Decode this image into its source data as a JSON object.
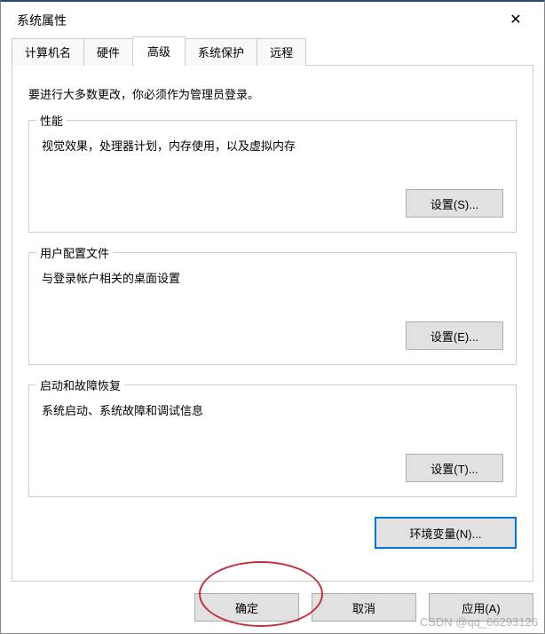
{
  "window": {
    "title": "系统属性"
  },
  "tabs": {
    "computer_name": "计算机名",
    "hardware": "硬件",
    "advanced": "高级",
    "system_protection": "系统保护",
    "remote": "远程"
  },
  "panel": {
    "instruction": "要进行大多数更改，你必须作为管理员登录。",
    "performance": {
      "title": "性能",
      "desc": "视觉效果，处理器计划，内存使用，以及虚拟内存",
      "button": "设置(S)..."
    },
    "user_profiles": {
      "title": "用户配置文件",
      "desc": "与登录帐户相关的桌面设置",
      "button": "设置(E)..."
    },
    "startup": {
      "title": "启动和故障恢复",
      "desc": "系统启动、系统故障和调试信息",
      "button": "设置(T)..."
    },
    "env_button": "环境变量(N)..."
  },
  "footer": {
    "ok": "确定",
    "cancel": "取消",
    "apply": "应用(A)"
  },
  "watermark": "CSDN @qq_66293126"
}
